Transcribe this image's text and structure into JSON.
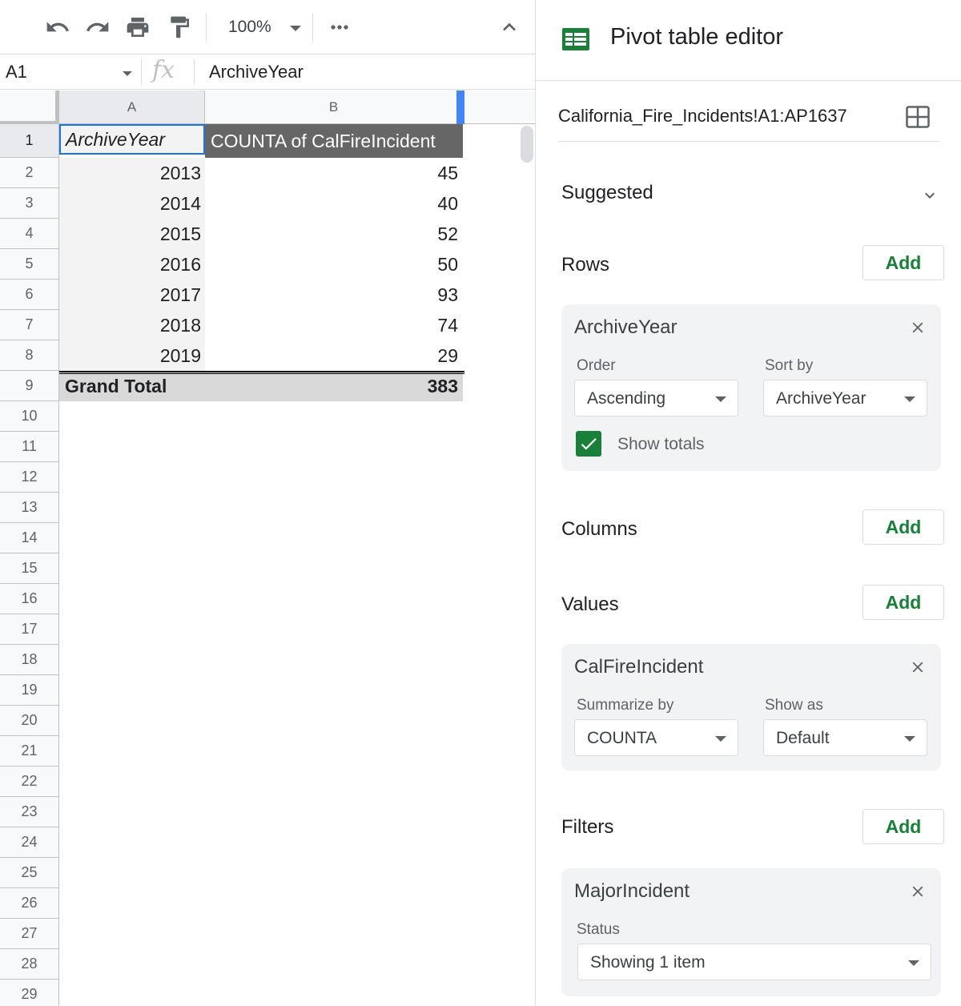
{
  "toolbar": {
    "zoom": "100%"
  },
  "formula_bar": {
    "cell_ref": "A1",
    "fx": "fx",
    "value": "ArchiveYear"
  },
  "grid": {
    "columns": [
      "A",
      "B"
    ],
    "row_numbers": [
      "1",
      "2",
      "3",
      "4",
      "5",
      "6",
      "7",
      "8",
      "9",
      "10",
      "11",
      "12",
      "13",
      "14",
      "15",
      "16",
      "17",
      "18",
      "19",
      "20",
      "21",
      "22",
      "23",
      "24",
      "25",
      "26",
      "27",
      "28",
      "29"
    ],
    "pivot": {
      "header_a": "ArchiveYear",
      "header_b": "COUNTA of CalFireIncident",
      "rows": [
        {
          "year": "2013",
          "count": "45"
        },
        {
          "year": "2014",
          "count": "40"
        },
        {
          "year": "2015",
          "count": "52"
        },
        {
          "year": "2016",
          "count": "50"
        },
        {
          "year": "2017",
          "count": "93"
        },
        {
          "year": "2018",
          "count": "74"
        },
        {
          "year": "2019",
          "count": "29"
        }
      ],
      "total_label": "Grand Total",
      "total_value": "383"
    }
  },
  "editor": {
    "title": "Pivot table editor",
    "range": "California_Fire_Incidents!A1:AP1637",
    "suggested_label": "Suggested",
    "add_label": "Add",
    "rows": {
      "label": "Rows",
      "field": "ArchiveYear",
      "order_label": "Order",
      "order_value": "Ascending",
      "sort_label": "Sort by",
      "sort_value": "ArchiveYear",
      "show_totals_label": "Show totals",
      "show_totals_checked": true
    },
    "columns": {
      "label": "Columns"
    },
    "values": {
      "label": "Values",
      "field": "CalFireIncident",
      "summarize_label": "Summarize by",
      "summarize_value": "COUNTA",
      "show_as_label": "Show as",
      "show_as_value": "Default"
    },
    "filters": {
      "label": "Filters",
      "field": "MajorIncident",
      "status_label": "Status",
      "status_value": "Showing 1 item"
    }
  },
  "colors": {
    "accent_green": "#188038",
    "selection_blue": "#1a73e8",
    "pivot_header_bg": "#666666",
    "grand_total_bg": "#d9d9d9"
  }
}
